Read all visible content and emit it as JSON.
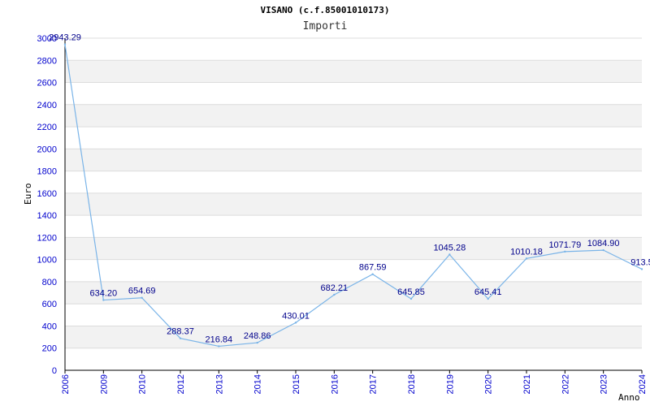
{
  "chart_data": {
    "type": "line",
    "title": "VISANO (c.f.85001010173)",
    "subtitle": "Importi",
    "xlabel": "Anno",
    "ylabel": "Euro",
    "ylim": [
      0,
      3000
    ],
    "yticks": [
      0,
      200,
      400,
      600,
      800,
      1000,
      1200,
      1400,
      1600,
      1800,
      2000,
      2200,
      2400,
      2600,
      2800,
      3000
    ],
    "categories": [
      "2006",
      "2009",
      "2010",
      "2012",
      "2013",
      "2014",
      "2015",
      "2016",
      "2017",
      "2018",
      "2019",
      "2020",
      "2021",
      "2022",
      "2023",
      "2024"
    ],
    "values": [
      2943.29,
      634.2,
      654.69,
      288.37,
      216.84,
      248.86,
      430.01,
      682.21,
      867.59,
      645.85,
      1045.28,
      645.41,
      1010.18,
      1071.79,
      1084.9,
      913.5
    ],
    "value_labels": [
      "2943.29",
      "634.20",
      "654.69",
      "288.37",
      "216.84",
      "248.86",
      "430.01",
      "682.21",
      "867.59",
      "645.85",
      "1045.28",
      "645.41",
      "1010.18",
      "1071.79",
      "1084.90",
      "913.5"
    ],
    "grid": true,
    "colors": {
      "line": "#7ab4e8",
      "label": "#00008b",
      "axis_text": "#0000cd",
      "band": "#f2f2f2"
    }
  }
}
